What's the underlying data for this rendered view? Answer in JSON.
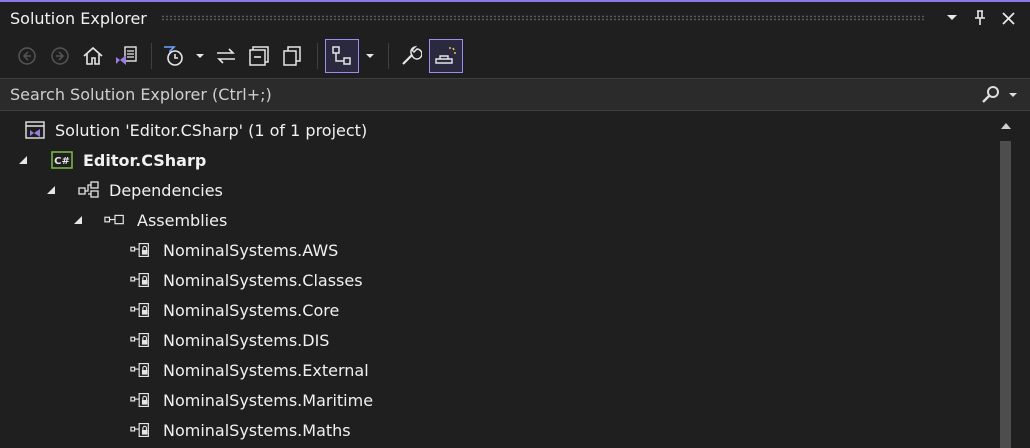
{
  "window": {
    "title": "Solution Explorer"
  },
  "title_buttons": [
    {
      "name": "window-position-dropdown-icon"
    },
    {
      "name": "pin-icon"
    },
    {
      "name": "close-icon"
    }
  ],
  "toolbar": {
    "items": [
      {
        "name": "back-icon",
        "state": "disabled"
      },
      {
        "name": "forward-icon",
        "state": "disabled"
      },
      {
        "name": "home-icon",
        "state": "normal"
      },
      {
        "name": "switch-views-icon",
        "state": "normal"
      },
      {
        "name": "pending-changes-filter-icon",
        "state": "normal"
      },
      {
        "name": "sync-with-active-document-icon",
        "state": "normal"
      },
      {
        "name": "collapse-all-icon",
        "state": "normal"
      },
      {
        "name": "show-all-files-icon",
        "state": "normal"
      },
      {
        "name": "show-tree-view-icon",
        "state": "active"
      },
      {
        "name": "properties-icon",
        "state": "normal"
      },
      {
        "name": "preview-selected-items-icon",
        "state": "active"
      }
    ]
  },
  "search": {
    "placeholder": "Search Solution Explorer (Ctrl+;)",
    "value": ""
  },
  "tree": {
    "solution": {
      "label": "Solution 'Editor.CSharp' (1 of 1 project)",
      "icon": "solution-icon"
    },
    "project": {
      "label": "Editor.CSharp",
      "icon": "csharp-project-icon",
      "expanded": true
    },
    "dependencies": {
      "label": "Dependencies",
      "icon": "dependencies-icon",
      "expanded": true
    },
    "assemblies": {
      "label": "Assemblies",
      "icon": "assemblies-icon",
      "expanded": true
    },
    "assembly_items": [
      {
        "label": "NominalSystems.AWS"
      },
      {
        "label": "NominalSystems.Classes"
      },
      {
        "label": "NominalSystems.Core"
      },
      {
        "label": "NominalSystems.DIS"
      },
      {
        "label": "NominalSystems.External"
      },
      {
        "label": "NominalSystems.Maritime"
      },
      {
        "label": "NominalSystems.Maths"
      }
    ]
  },
  "colors": {
    "background": "#1f1f1f",
    "accent": "#8b78e6",
    "search_background": "#2b2b2b",
    "csharp_icon": "#79c24a",
    "vs_purple": "#9b7be0"
  }
}
